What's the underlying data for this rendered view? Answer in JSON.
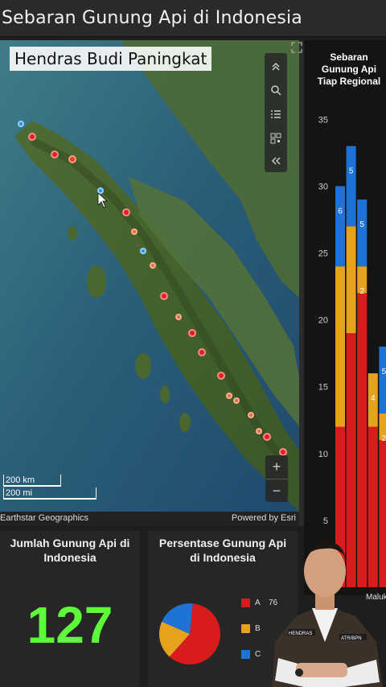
{
  "app": {
    "title": "Sebaran Gunung Api di Indonesia"
  },
  "overlay": {
    "presenter_name": "Hendras Budi Paningkat"
  },
  "map": {
    "attribution": "Earthstar Geographics",
    "powered_by": "Powered by Esri",
    "scale_km": "200 km",
    "scale_mi": "200 mi",
    "zoom_in": "+",
    "zoom_out": "−",
    "tools": [
      "chevrons-up-icon",
      "search-icon",
      "layer-list-icon",
      "qr-code-icon",
      "collapse-icon"
    ],
    "volcano_markers_red": 17,
    "volcano_markers_blue": 3
  },
  "chart": {
    "title_lines": [
      "Sebaran",
      "Gunung Api",
      "Tiap Regional"
    ],
    "bottom_label": "Maluku"
  },
  "chart_data": {
    "type": "bar",
    "stacked": true,
    "ylim": [
      0,
      35
    ],
    "y_ticks": [
      5,
      10,
      15,
      20,
      25,
      30,
      35
    ],
    "series_colors": {
      "A": "#d71c1c",
      "B": "#e6a21d",
      "C": "#1f73d6"
    },
    "bars": [
      {
        "A": 12,
        "B": 12,
        "C": 6,
        "labels": {
          "C": "6"
        }
      },
      {
        "A": 19,
        "B": 8,
        "C": 6,
        "labels": {
          "C": "5"
        }
      },
      {
        "A": 22,
        "B": 2,
        "C": 5,
        "labels": {
          "B": "2",
          "C": "5"
        }
      },
      {
        "A": 12,
        "B": 4,
        "C": 0,
        "labels": {
          "B": "4"
        }
      },
      {
        "A": 11,
        "B": 2,
        "C": 5,
        "labels": {
          "B": "2",
          "C": "5"
        }
      }
    ]
  },
  "summary": {
    "count_title_1": "Jumlah Gunung Api di",
    "count_title_2": "Indonesia",
    "count_value": "127",
    "pct_title_1": "Persentase Gunung Api",
    "pct_title_2": "di Indonesia"
  },
  "pie": {
    "slices": [
      {
        "label": "A",
        "value": 76,
        "color": "#d71c1c"
      },
      {
        "label": "B",
        "value": 0.2,
        "color": "#e6a21d"
      },
      {
        "label": "C",
        "value": 0.2,
        "color": "#1f73d6"
      }
    ],
    "legend": [
      {
        "label": "A",
        "value_text": "76",
        "color": "#d71c1c"
      },
      {
        "label": "B",
        "value_text": "",
        "color": "#e6a21d"
      },
      {
        "label": "C",
        "value_text": "",
        "color": "#1f73d6"
      }
    ]
  },
  "presenter_badges": {
    "left": "HENDRAS",
    "right": "ATR/BPN"
  }
}
